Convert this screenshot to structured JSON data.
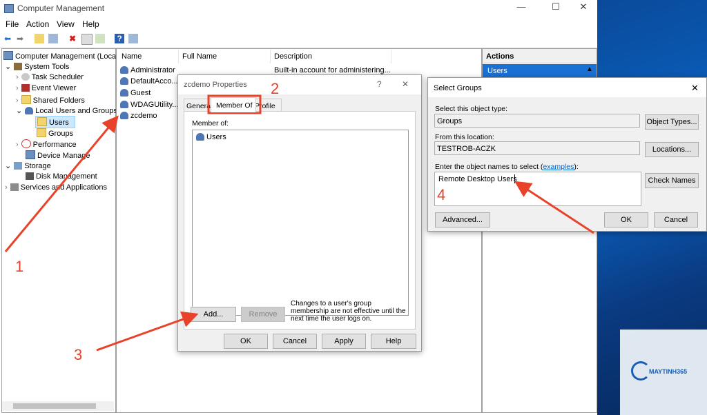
{
  "window": {
    "title": "Computer Management",
    "menu": [
      "File",
      "Action",
      "View",
      "Help"
    ]
  },
  "tree": [
    {
      "label": "Computer Management (Local",
      "level": 0
    },
    {
      "label": "System Tools",
      "level": 1
    },
    {
      "label": "Task Scheduler",
      "level": 2
    },
    {
      "label": "Event Viewer",
      "level": 2
    },
    {
      "label": "Shared Folders",
      "level": 2
    },
    {
      "label": "Local Users and Groups",
      "level": 2
    },
    {
      "label": "Users",
      "level": 3
    },
    {
      "label": "Groups",
      "level": 3
    },
    {
      "label": "Performance",
      "level": 2
    },
    {
      "label": "Device Manage",
      "level": 2
    },
    {
      "label": "Storage",
      "level": 1
    },
    {
      "label": "Disk Management",
      "level": 2
    },
    {
      "label": "Services and Applications",
      "level": 1
    }
  ],
  "list": {
    "columns": [
      "Name",
      "Full Name",
      "Description"
    ],
    "rows": [
      {
        "name": "Administrator",
        "description": "Built-in account for administering..."
      },
      {
        "name": "DefaultAcco...",
        "description": ""
      },
      {
        "name": "Guest",
        "description": ""
      },
      {
        "name": "WDAGUtility...",
        "description": ""
      },
      {
        "name": "zcdemo",
        "description": ""
      }
    ]
  },
  "actions": {
    "header": "Actions",
    "section": "Users"
  },
  "properties_dialog": {
    "title": "zcdemo Properties",
    "help": "?",
    "close": "✕",
    "tabs": [
      "General",
      "Member Of",
      "Profile"
    ],
    "member_of_label": "Member of:",
    "members": [
      "Users"
    ],
    "add": "Add...",
    "remove": "Remove",
    "note": "Changes to a user's group membership are not effective until the next time the user logs on.",
    "ok": "OK",
    "cancel": "Cancel",
    "apply": "Apply",
    "helpbtn": "Help"
  },
  "select_dialog": {
    "title": "Select Groups",
    "close": "✕",
    "object_type_label": "Select this object type:",
    "object_type": "Groups",
    "object_types_btn": "Object Types...",
    "location_label": "From this location:",
    "location": "TESTROB-ACZK",
    "locations_btn": "Locations...",
    "names_label": "Enter the object names to select (",
    "names_link": "examples",
    "names_label_end": "):",
    "names_value": "Remote Desktop Users",
    "check_names": "Check Names",
    "advanced": "Advanced...",
    "ok": "OK",
    "cancel": "Cancel"
  },
  "annotations": [
    "1",
    "2",
    "3",
    "4"
  ],
  "watermark": {
    "brand": "MAYTINH365"
  },
  "colors": {
    "annotation": "#e8432a",
    "accent": "#0078d7"
  }
}
